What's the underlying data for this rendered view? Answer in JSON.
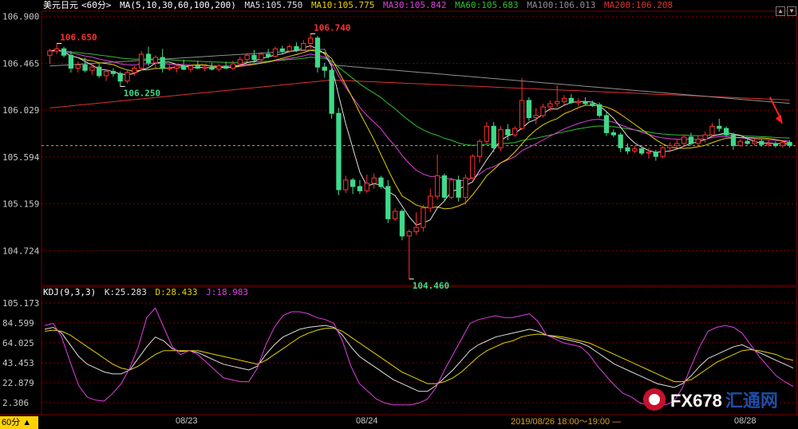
{
  "legend": {
    "symbol": "美元日元",
    "period": "<60分>",
    "ma_params": "MA(5,10,30,60,100,200)",
    "ma5": "MA5:105.750",
    "ma10": "MA10:105.775",
    "ma30": "MA30:105.842",
    "ma60": "MA60:105.683",
    "ma100": "MA100:106.013",
    "ma200": "MA200:106.208"
  },
  "kdj_legend": {
    "params": "KDJ(9,3,3)",
    "k": "K:25.283",
    "d": "D:28.433",
    "j": "J:18.983"
  },
  "period_button": "60分 ▲",
  "time_tip": "2019/08/26 18:00～19:00 —",
  "watermark": {
    "brand": "FX678",
    "cn": "汇通网"
  },
  "colors": {
    "up": "#ff3232",
    "down": "#40d98a",
    "ma5": "#e0e0e0",
    "ma10": "#e6d200",
    "ma30": "#e040e0",
    "ma60": "#30c030",
    "ma100": "#909090",
    "ma200": "#e03030",
    "k": "#e0e0e0",
    "d": "#e6d200",
    "j": "#e040e0",
    "grid": "#7a0000",
    "axis": "#c8c8c8"
  },
  "chart_data": [
    {
      "type": "candlestick",
      "title": "美元日元 60分",
      "x_labels": [
        "08/23",
        "08/24",
        "08/28"
      ],
      "y_ticks": [
        106.9,
        106.465,
        106.029,
        105.594,
        105.159,
        104.724
      ],
      "ylim": [
        104.4,
        106.95
      ],
      "current_price": 105.7,
      "annotations": [
        {
          "text": "106.650",
          "value": 106.65,
          "type": "high"
        },
        {
          "text": "106.250",
          "value": 106.25,
          "type": "low"
        },
        {
          "text": "106.740",
          "value": 106.74,
          "type": "high"
        },
        {
          "text": "104.460",
          "value": 104.46,
          "type": "low"
        }
      ],
      "candles": [
        {
          "o": 106.54,
          "h": 106.6,
          "l": 106.46,
          "c": 106.58
        },
        {
          "o": 106.58,
          "h": 106.65,
          "l": 106.55,
          "c": 106.6
        },
        {
          "o": 106.6,
          "h": 106.62,
          "l": 106.52,
          "c": 106.54
        },
        {
          "o": 106.54,
          "h": 106.58,
          "l": 106.38,
          "c": 106.42
        },
        {
          "o": 106.42,
          "h": 106.48,
          "l": 106.38,
          "c": 106.45
        },
        {
          "o": 106.45,
          "h": 106.52,
          "l": 106.38,
          "c": 106.4
        },
        {
          "o": 106.4,
          "h": 106.46,
          "l": 106.36,
          "c": 106.43
        },
        {
          "o": 106.43,
          "h": 106.47,
          "l": 106.33,
          "c": 106.35
        },
        {
          "o": 106.35,
          "h": 106.41,
          "l": 106.3,
          "c": 106.39
        },
        {
          "o": 106.39,
          "h": 106.42,
          "l": 106.34,
          "c": 106.37
        },
        {
          "o": 106.37,
          "h": 106.39,
          "l": 106.25,
          "c": 106.3
        },
        {
          "o": 106.3,
          "h": 106.41,
          "l": 106.28,
          "c": 106.38
        },
        {
          "o": 106.38,
          "h": 106.44,
          "l": 106.35,
          "c": 106.42
        },
        {
          "o": 106.42,
          "h": 106.58,
          "l": 106.4,
          "c": 106.55
        },
        {
          "o": 106.55,
          "h": 106.62,
          "l": 106.44,
          "c": 106.47
        },
        {
          "o": 106.47,
          "h": 106.54,
          "l": 106.42,
          "c": 106.52
        },
        {
          "o": 106.52,
          "h": 106.6,
          "l": 106.38,
          "c": 106.42
        },
        {
          "o": 106.42,
          "h": 106.45,
          "l": 106.4,
          "c": 106.42
        },
        {
          "o": 106.42,
          "h": 106.46,
          "l": 106.38,
          "c": 106.44
        },
        {
          "o": 106.44,
          "h": 106.5,
          "l": 106.4,
          "c": 106.41
        },
        {
          "o": 106.41,
          "h": 106.45,
          "l": 106.38,
          "c": 106.44
        },
        {
          "o": 106.44,
          "h": 106.49,
          "l": 106.41,
          "c": 106.42
        },
        {
          "o": 106.42,
          "h": 106.45,
          "l": 106.39,
          "c": 106.43
        },
        {
          "o": 106.43,
          "h": 106.47,
          "l": 106.4,
          "c": 106.41
        },
        {
          "o": 106.41,
          "h": 106.46,
          "l": 106.39,
          "c": 106.44
        },
        {
          "o": 106.44,
          "h": 106.48,
          "l": 106.41,
          "c": 106.42
        },
        {
          "o": 106.42,
          "h": 106.49,
          "l": 106.4,
          "c": 106.46
        },
        {
          "o": 106.46,
          "h": 106.53,
          "l": 106.43,
          "c": 106.5
        },
        {
          "o": 106.5,
          "h": 106.56,
          "l": 106.48,
          "c": 106.54
        },
        {
          "o": 106.54,
          "h": 106.59,
          "l": 106.47,
          "c": 106.5
        },
        {
          "o": 106.5,
          "h": 106.57,
          "l": 106.48,
          "c": 106.55
        },
        {
          "o": 106.55,
          "h": 106.6,
          "l": 106.51,
          "c": 106.53
        },
        {
          "o": 106.53,
          "h": 106.62,
          "l": 106.52,
          "c": 106.6
        },
        {
          "o": 106.6,
          "h": 106.63,
          "l": 106.55,
          "c": 106.58
        },
        {
          "o": 106.58,
          "h": 106.64,
          "l": 106.56,
          "c": 106.62
        },
        {
          "o": 106.62,
          "h": 106.66,
          "l": 106.57,
          "c": 106.59
        },
        {
          "o": 106.59,
          "h": 106.68,
          "l": 106.58,
          "c": 106.65
        },
        {
          "o": 106.65,
          "h": 106.74,
          "l": 106.6,
          "c": 106.7
        },
        {
          "o": 106.7,
          "h": 106.72,
          "l": 106.38,
          "c": 106.43
        },
        {
          "o": 106.43,
          "h": 106.47,
          "l": 106.33,
          "c": 106.4
        },
        {
          "o": 106.4,
          "h": 106.42,
          "l": 105.95,
          "c": 106.0
        },
        {
          "o": 106.0,
          "h": 106.05,
          "l": 105.24,
          "c": 105.29
        },
        {
          "o": 105.29,
          "h": 105.42,
          "l": 105.26,
          "c": 105.38
        },
        {
          "o": 105.38,
          "h": 105.4,
          "l": 105.25,
          "c": 105.32
        },
        {
          "o": 105.32,
          "h": 105.38,
          "l": 105.25,
          "c": 105.28
        },
        {
          "o": 105.28,
          "h": 105.43,
          "l": 105.26,
          "c": 105.35
        },
        {
          "o": 105.35,
          "h": 105.44,
          "l": 105.3,
          "c": 105.4
        },
        {
          "o": 105.4,
          "h": 105.42,
          "l": 105.3,
          "c": 105.32
        },
        {
          "o": 105.32,
          "h": 105.38,
          "l": 104.98,
          "c": 105.02
        },
        {
          "o": 105.02,
          "h": 105.12,
          "l": 105.0,
          "c": 105.09
        },
        {
          "o": 105.09,
          "h": 105.11,
          "l": 104.82,
          "c": 104.86
        },
        {
          "o": 104.86,
          "h": 104.92,
          "l": 104.46,
          "c": 104.9
        },
        {
          "o": 104.9,
          "h": 105.08,
          "l": 104.87,
          "c": 104.94
        },
        {
          "o": 104.94,
          "h": 105.15,
          "l": 104.9,
          "c": 105.12
        },
        {
          "o": 105.12,
          "h": 105.3,
          "l": 105.08,
          "c": 105.23
        },
        {
          "o": 105.23,
          "h": 105.62,
          "l": 105.2,
          "c": 105.42
        },
        {
          "o": 105.42,
          "h": 105.44,
          "l": 105.18,
          "c": 105.22
        },
        {
          "o": 105.22,
          "h": 105.4,
          "l": 105.2,
          "c": 105.38
        },
        {
          "o": 105.38,
          "h": 105.42,
          "l": 105.18,
          "c": 105.22
        },
        {
          "o": 105.22,
          "h": 105.43,
          "l": 105.15,
          "c": 105.4
        },
        {
          "o": 105.4,
          "h": 105.62,
          "l": 105.38,
          "c": 105.6
        },
        {
          "o": 105.6,
          "h": 105.76,
          "l": 105.54,
          "c": 105.74
        },
        {
          "o": 105.74,
          "h": 105.92,
          "l": 105.72,
          "c": 105.88
        },
        {
          "o": 105.88,
          "h": 105.92,
          "l": 105.64,
          "c": 105.68
        },
        {
          "o": 105.68,
          "h": 105.88,
          "l": 105.65,
          "c": 105.85
        },
        {
          "o": 105.85,
          "h": 105.9,
          "l": 105.75,
          "c": 105.8
        },
        {
          "o": 105.8,
          "h": 105.88,
          "l": 105.78,
          "c": 105.86
        },
        {
          "o": 105.86,
          "h": 106.33,
          "l": 105.84,
          "c": 106.12
        },
        {
          "o": 106.12,
          "h": 106.15,
          "l": 105.93,
          "c": 105.96
        },
        {
          "o": 105.96,
          "h": 106.05,
          "l": 105.9,
          "c": 105.98
        },
        {
          "o": 105.98,
          "h": 106.09,
          "l": 105.96,
          "c": 106.06
        },
        {
          "o": 106.06,
          "h": 106.12,
          "l": 106.02,
          "c": 106.09
        },
        {
          "o": 106.09,
          "h": 106.26,
          "l": 106.06,
          "c": 106.11
        },
        {
          "o": 106.11,
          "h": 106.17,
          "l": 106.08,
          "c": 106.14
        },
        {
          "o": 106.14,
          "h": 106.18,
          "l": 106.09,
          "c": 106.1
        },
        {
          "o": 106.1,
          "h": 106.14,
          "l": 106.07,
          "c": 106.11
        },
        {
          "o": 106.11,
          "h": 106.15,
          "l": 106.08,
          "c": 106.09
        },
        {
          "o": 106.09,
          "h": 106.12,
          "l": 106.06,
          "c": 106.08
        },
        {
          "o": 106.08,
          "h": 106.1,
          "l": 105.96,
          "c": 105.98
        },
        {
          "o": 105.98,
          "h": 106.01,
          "l": 105.79,
          "c": 105.82
        },
        {
          "o": 105.82,
          "h": 105.85,
          "l": 105.78,
          "c": 105.8
        },
        {
          "o": 105.8,
          "h": 105.82,
          "l": 105.64,
          "c": 105.68
        },
        {
          "o": 105.68,
          "h": 105.72,
          "l": 105.62,
          "c": 105.65
        },
        {
          "o": 105.65,
          "h": 105.7,
          "l": 105.63,
          "c": 105.67
        },
        {
          "o": 105.67,
          "h": 105.69,
          "l": 105.61,
          "c": 105.63
        },
        {
          "o": 105.63,
          "h": 105.68,
          "l": 105.58,
          "c": 105.64
        },
        {
          "o": 105.64,
          "h": 105.66,
          "l": 105.56,
          "c": 105.6
        },
        {
          "o": 105.6,
          "h": 105.7,
          "l": 105.58,
          "c": 105.68
        },
        {
          "o": 105.68,
          "h": 105.73,
          "l": 105.65,
          "c": 105.7
        },
        {
          "o": 105.7,
          "h": 105.76,
          "l": 105.68,
          "c": 105.72
        },
        {
          "o": 105.72,
          "h": 105.8,
          "l": 105.69,
          "c": 105.78
        },
        {
          "o": 105.78,
          "h": 105.82,
          "l": 105.7,
          "c": 105.72
        },
        {
          "o": 105.72,
          "h": 105.79,
          "l": 105.7,
          "c": 105.76
        },
        {
          "o": 105.76,
          "h": 105.83,
          "l": 105.73,
          "c": 105.8
        },
        {
          "o": 105.8,
          "h": 105.91,
          "l": 105.78,
          "c": 105.88
        },
        {
          "o": 105.88,
          "h": 105.95,
          "l": 105.83,
          "c": 105.86
        },
        {
          "o": 105.86,
          "h": 105.88,
          "l": 105.78,
          "c": 105.8
        },
        {
          "o": 105.8,
          "h": 105.82,
          "l": 105.66,
          "c": 105.7
        },
        {
          "o": 105.7,
          "h": 105.76,
          "l": 105.69,
          "c": 105.74
        },
        {
          "o": 105.74,
          "h": 105.78,
          "l": 105.71,
          "c": 105.72
        },
        {
          "o": 105.72,
          "h": 105.76,
          "l": 105.7,
          "c": 105.74
        },
        {
          "o": 105.74,
          "h": 105.76,
          "l": 105.69,
          "c": 105.71
        },
        {
          "o": 105.71,
          "h": 105.75,
          "l": 105.69,
          "c": 105.72
        },
        {
          "o": 105.72,
          "h": 105.74,
          "l": 105.68,
          "c": 105.7
        },
        {
          "o": 105.7,
          "h": 105.75,
          "l": 105.68,
          "c": 105.73
        },
        {
          "o": 105.73,
          "h": 105.75,
          "l": 105.68,
          "c": 105.7
        }
      ]
    },
    {
      "type": "line",
      "title": "KDJ(9,3,3)",
      "y_ticks": [
        105.173,
        84.599,
        64.025,
        43.453,
        22.879,
        2.306
      ],
      "ylim": [
        -10,
        110
      ],
      "series": [
        {
          "name": "K",
          "values": [
            78,
            80,
            74,
            62,
            50,
            42,
            38,
            34,
            32,
            32,
            36,
            48,
            60,
            70,
            66,
            58,
            55,
            56,
            54,
            50,
            46,
            42,
            40,
            38,
            36,
            40,
            52,
            62,
            70,
            74,
            78,
            80,
            81,
            82,
            80,
            72,
            60,
            50,
            44,
            38,
            32,
            26,
            22,
            18,
            14,
            14,
            20,
            28,
            36,
            46,
            56,
            62,
            66,
            70,
            72,
            74,
            76,
            78,
            76,
            72,
            70,
            68,
            66,
            64,
            60,
            54,
            48,
            42,
            38,
            34,
            30,
            26,
            22,
            20,
            18,
            22,
            30,
            40,
            48,
            52,
            56,
            60,
            62,
            58,
            54,
            50,
            46,
            42,
            38
          ]
        },
        {
          "name": "D",
          "values": [
            76,
            77,
            76,
            72,
            66,
            60,
            54,
            48,
            42,
            38,
            36,
            40,
            46,
            52,
            56,
            56,
            56,
            56,
            56,
            54,
            52,
            50,
            48,
            46,
            44,
            42,
            46,
            52,
            58,
            64,
            70,
            74,
            77,
            79,
            79,
            76,
            70,
            64,
            58,
            52,
            46,
            40,
            34,
            30,
            26,
            22,
            22,
            24,
            28,
            34,
            42,
            50,
            56,
            60,
            64,
            66,
            70,
            72,
            73,
            72,
            71,
            70,
            68,
            66,
            64,
            60,
            56,
            52,
            48,
            44,
            40,
            36,
            32,
            28,
            24,
            24,
            26,
            32,
            38,
            44,
            48,
            52,
            56,
            57,
            56,
            54,
            52,
            48,
            46
          ]
        },
        {
          "name": "J",
          "values": [
            82,
            84,
            70,
            44,
            20,
            8,
            5,
            4,
            12,
            22,
            38,
            60,
            90,
            100,
            80,
            60,
            52,
            56,
            52,
            44,
            36,
            28,
            26,
            24,
            24,
            38,
            62,
            80,
            92,
            96,
            96,
            94,
            90,
            88,
            84,
            66,
            40,
            22,
            14,
            6,
            2,
            0,
            0,
            0,
            2,
            6,
            18,
            36,
            52,
            68,
            84,
            88,
            90,
            92,
            90,
            90,
            92,
            94,
            86,
            72,
            68,
            64,
            62,
            60,
            52,
            40,
            30,
            20,
            12,
            8,
            2,
            0,
            0,
            0,
            4,
            18,
            40,
            60,
            76,
            80,
            82,
            80,
            74,
            62,
            50,
            40,
            30,
            24,
            19
          ]
        }
      ]
    }
  ]
}
